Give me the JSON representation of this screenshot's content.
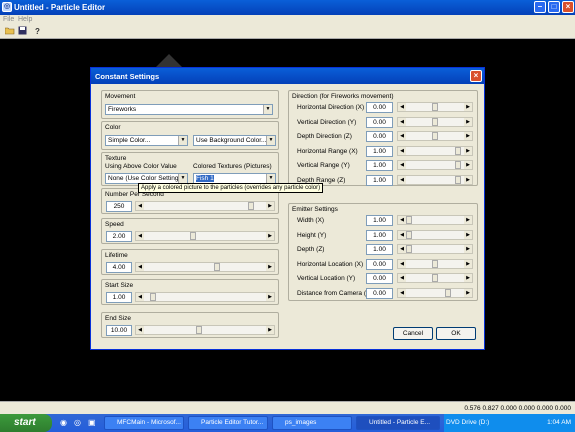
{
  "app": {
    "title": "Untitled - Particle Editor"
  },
  "menu": [
    "File",
    "Help"
  ],
  "toolbar": {
    "icons": [
      "open-icon",
      "save-icon",
      "help-icon"
    ],
    "help_glyph": "?"
  },
  "dialog": {
    "title": "Constant Settings",
    "movement": {
      "label": "Movement",
      "value": "Fireworks"
    },
    "color": {
      "label": "Color",
      "value1": "Simple Color...",
      "value2": "Use Background Color..."
    },
    "texture": {
      "label": "Texture",
      "above_label": "Using Above Color Value",
      "colored_label": "Colored Textures (Pictures)",
      "value1": "None (Use Color Settings)",
      "value2": "Fish 1"
    },
    "tooltip": "Apply a colored picture to the particles (overrides any particle color)",
    "number_per_second": {
      "label": "Number Per Second",
      "value": "250",
      "level": 0.9
    },
    "speed": {
      "label": "Speed",
      "value": "2.00",
      "level": 0.4
    },
    "lifetime": {
      "label": "Lifetime",
      "value": "4.00",
      "level": 0.6
    },
    "start_size": {
      "label": "Start Size",
      "value": "1.00",
      "level": 0.05
    },
    "end_size": {
      "label": "End Size",
      "value": "10.00",
      "level": 0.45
    },
    "direction": {
      "label": "Direction (for Fireworks movement)",
      "rows": [
        {
          "label": "Horizontal Direction (X)",
          "value": "0.00",
          "level": 0.5
        },
        {
          "label": "Vertical Direction (Y)",
          "value": "0.00",
          "level": 0.5
        },
        {
          "label": "Depth Direction (Z)",
          "value": "0.00",
          "level": 0.5
        },
        {
          "label": "Horizontal Range (X)",
          "value": "1.00",
          "level": 0.95
        },
        {
          "label": "Vertical Range (Y)",
          "value": "1.00",
          "level": 0.95
        },
        {
          "label": "Depth Range (Z)",
          "value": "1.00",
          "level": 0.95
        }
      ]
    },
    "emitter": {
      "label": "Emitter Settings",
      "rows": [
        {
          "label": "Width (X)",
          "value": "1.00",
          "level": 0.0
        },
        {
          "label": "Height (Y)",
          "value": "1.00",
          "level": 0.0
        },
        {
          "label": "Depth (Z)",
          "value": "1.00",
          "level": 0.0
        },
        {
          "label": "Horizontal Location (X)",
          "value": "0.00",
          "level": 0.5
        },
        {
          "label": "Vertical Location (Y)",
          "value": "0.00",
          "level": 0.5
        },
        {
          "label": "Distance from Camera (Z)",
          "value": "0.00",
          "level": 0.75
        }
      ]
    },
    "cancel": "Cancel",
    "ok": "OK"
  },
  "status": {
    "text": "0.576  0.827  0.000  0.000  0.000  0.000"
  },
  "taskbar": {
    "start": "start",
    "items": [
      "MFCMain - Microsof...",
      "Particle Editor Tutor...",
      "ps_images",
      "Untitled - Particle E..."
    ],
    "tray_text": "DVD Drive (D:)",
    "time": "1:04 AM"
  },
  "colors": {
    "title_blue": "#0a5fd8",
    "close_red": "#d9502c",
    "dialog_bg": "#ece9d8"
  }
}
